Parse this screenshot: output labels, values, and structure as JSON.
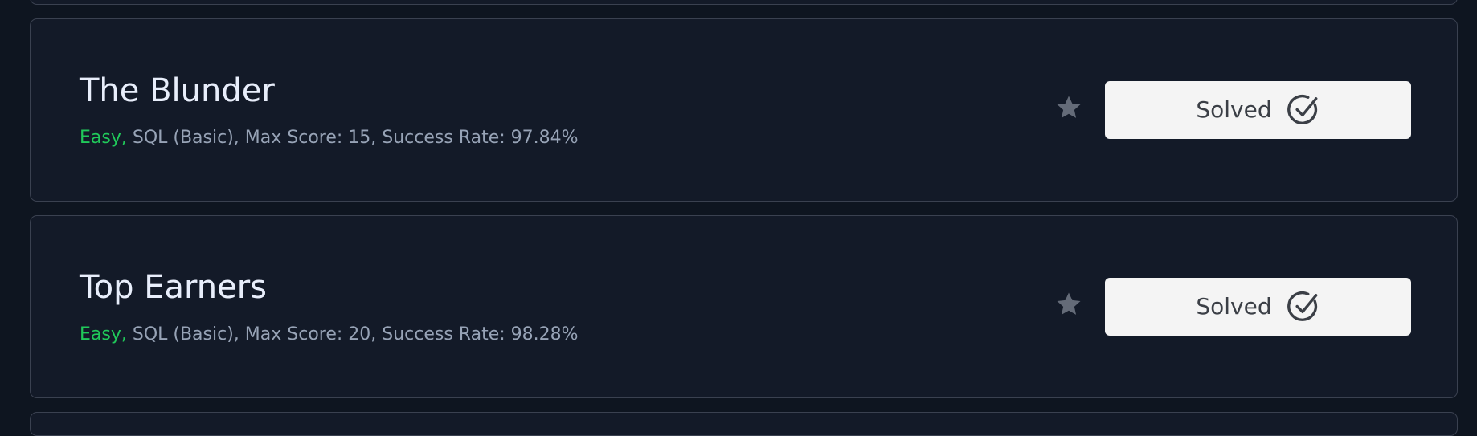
{
  "challenges": [
    {
      "title": "The Blunder",
      "difficulty": "Easy,",
      "details": " SQL (Basic), Max Score: 15, Success Rate: 97.84%",
      "status_label": "Solved"
    },
    {
      "title": "Top Earners",
      "difficulty": "Easy,",
      "details": " SQL (Basic), Max Score: 20, Success Rate: 98.28%",
      "status_label": "Solved"
    }
  ],
  "icons": {
    "bookmark": "star-icon",
    "status": "check-circle-icon"
  },
  "colors": {
    "background": "#0e1520",
    "card": "#131a28",
    "difficulty_easy": "#20c95a",
    "button": "#f4f4f4"
  }
}
